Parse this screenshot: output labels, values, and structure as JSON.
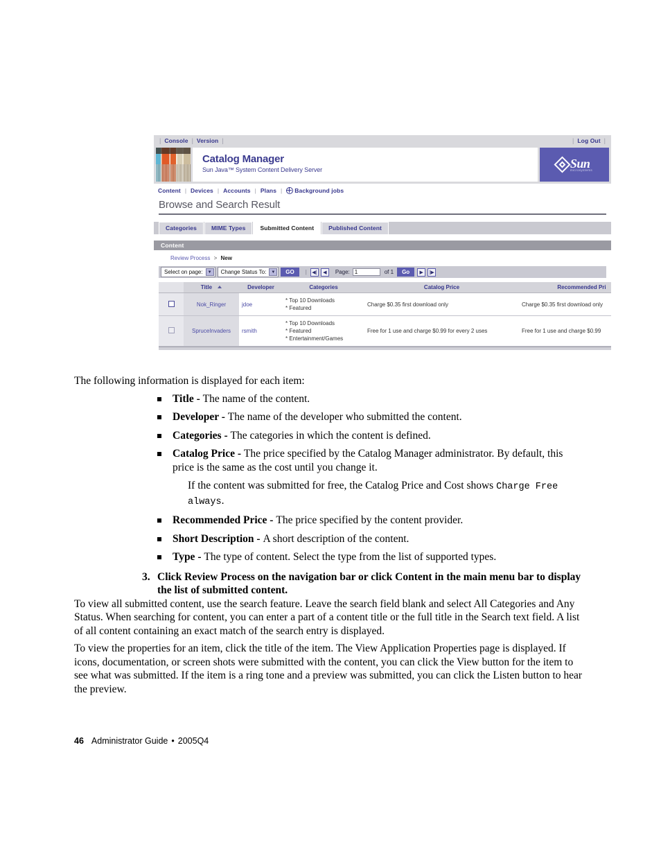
{
  "screenshot": {
    "util_bar": {
      "left_links": [
        "Console",
        "Version"
      ],
      "right_links": [
        "Log Out"
      ]
    },
    "masthead": {
      "title": "Catalog Manager",
      "subtitle": "Sun Java™ System Content Delivery Server",
      "logo_word": "Sun",
      "logo_tagline": "microsystems"
    },
    "main_nav": {
      "items": [
        "Content",
        "Devices",
        "Accounts",
        "Plans"
      ],
      "jobs_item": "Background jobs"
    },
    "page_title": "Browse and Search Result",
    "tabs": [
      {
        "label": "Categories",
        "active": false
      },
      {
        "label": "MIME Types",
        "active": false
      },
      {
        "label": "Submitted Content",
        "active": true
      },
      {
        "label": "Published Content",
        "active": false
      }
    ],
    "section_bar": {
      "label": "Content"
    },
    "breadcrumb": {
      "link": "Review Process",
      "separator": ">",
      "current": "New"
    },
    "toolbar": {
      "select_on_page": "Select on page:",
      "change_status_to": "Change Status To:",
      "go_uppercase": "GO",
      "separator": "|",
      "first_icon": "◀|",
      "prev_icon": "◀",
      "page_label": "Page:",
      "page_value": "1",
      "of_label": "of 1",
      "go_button": "Go",
      "next_icon": "▶",
      "last_icon": "|▶"
    },
    "table": {
      "headers": [
        "",
        "Title",
        "Developer",
        "Categories",
        "Catalog Price",
        "Recommended Pri"
      ],
      "sort_column": "Title",
      "sort_direction": "ascending",
      "rows": [
        {
          "checked": false,
          "title": "Nok_Ringer",
          "developer": "jdoe",
          "categories": [
            "* Top 10 Downloads",
            "* Featured"
          ],
          "catalog_price": "Charge $0.35 first download only",
          "recommended_price": "Charge $0.35 first download only"
        },
        {
          "checked": false,
          "title": "SpruceInvaders",
          "developer": "rsmith",
          "categories": [
            "* Top 10 Downloads",
            "* Featured",
            "* Entertainment/Games"
          ],
          "catalog_price": "Free for 1 use and charge $0.99 for every 2 uses",
          "recommended_price": "Free for 1 use and charge $0.99"
        }
      ]
    },
    "colors": {
      "accent_purple": "#5b5bb0",
      "link_blue": "#36368c",
      "chrome_gray": "#d9d9dd",
      "section_bar_gray": "#9a9aa2"
    }
  },
  "document": {
    "intro": "The following information is displayed for each item:",
    "bullets": [
      {
        "term": "Title - ",
        "text": "The name of the content."
      },
      {
        "term": "Developer - ",
        "text": "The name of the developer who submitted the content."
      },
      {
        "term": "Categories - ",
        "text": "The categories in which the content is defined."
      },
      {
        "term": "Catalog Price - ",
        "text": "The price specified by the Catalog Manager administrator. By default, this price is the same as the cost until you change it."
      },
      {
        "term": "Recommended Price - ",
        "text": "The price specified by the content provider."
      },
      {
        "term": "Short Description - ",
        "text": "A short description of the content."
      },
      {
        "term": "Type - ",
        "text": "The type of content. Select the type from the list of supported types."
      }
    ],
    "catalog_price_note_lead": "If the content was submitted for free, the Catalog Price and Cost shows ",
    "catalog_price_note_mono": "Charge Free always",
    "catalog_price_note_end": ".",
    "step_number": "3.",
    "step_text": "Click Review Process on the navigation bar or click Content in the main menu bar to display the list of submitted content.",
    "para_1": "To view all submitted content, use the search feature. Leave the search field blank and select All Categories and Any Status. When searching for content, you can enter a part of a content title or the full title in the Search text field. A list of all content containing an exact match of the search entry is displayed.",
    "para_2": "To view the properties for an item, click the title of the item. The View Application Properties page is displayed. If icons, documentation, or screen shots were submitted with the content, you can click the View button for the item to see what was submitted. If the item is a ring tone and a preview was submitted, you can click the Listen button to hear the preview."
  },
  "footer": {
    "page_number": "46",
    "guide_title": "Administrator Guide",
    "bullet": "•",
    "release": "2005Q4"
  }
}
